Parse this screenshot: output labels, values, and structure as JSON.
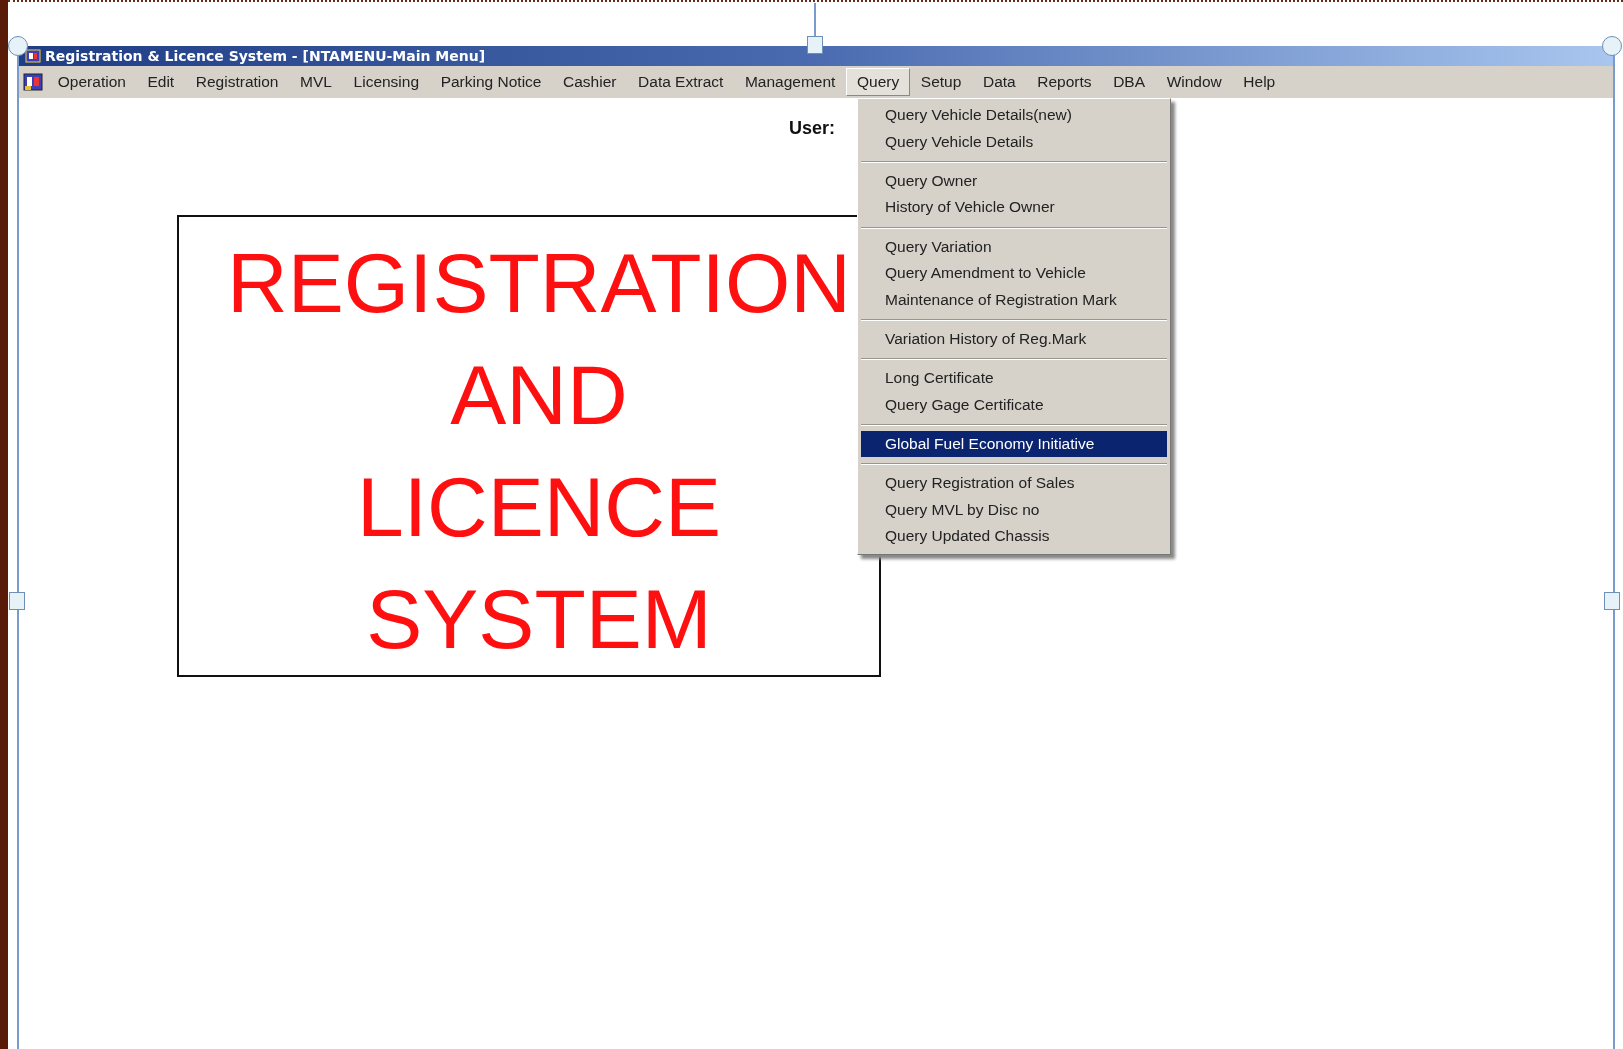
{
  "window": {
    "title": "Registration & Licence System - [NTAMENU-Main Menu]"
  },
  "menu_bar": [
    {
      "label": "Operation",
      "selected": false
    },
    {
      "label": "Edit",
      "selected": false
    },
    {
      "label": "Registration",
      "selected": false
    },
    {
      "label": "MVL",
      "selected": false
    },
    {
      "label": "Licensing",
      "selected": false
    },
    {
      "label": "Parking Notice",
      "selected": false
    },
    {
      "label": "Cashier",
      "selected": false
    },
    {
      "label": "Data Extract",
      "selected": false
    },
    {
      "label": "Management",
      "selected": false
    },
    {
      "label": "Query",
      "selected": true
    },
    {
      "label": "Setup",
      "selected": false
    },
    {
      "label": "Data",
      "selected": false
    },
    {
      "label": "Reports",
      "selected": false
    },
    {
      "label": "DBA",
      "selected": false
    },
    {
      "label": "Window",
      "selected": false
    },
    {
      "label": "Help",
      "selected": false
    }
  ],
  "user_label": "User:",
  "banner": {
    "lines": [
      "REGISTRATION",
      "AND",
      "LICENCE",
      "SYSTEM"
    ]
  },
  "dropdown": {
    "groups": [
      [
        {
          "label": "Query Vehicle Details(new)",
          "selected": false
        },
        {
          "label": "Query Vehicle Details",
          "selected": false
        }
      ],
      [
        {
          "label": "Query Owner",
          "selected": false
        },
        {
          "label": "History of Vehicle Owner",
          "selected": false
        }
      ],
      [
        {
          "label": "Query Variation",
          "selected": false
        },
        {
          "label": "Query Amendment to Vehicle",
          "selected": false
        },
        {
          "label": "Maintenance of Registration Mark",
          "selected": false
        }
      ],
      [
        {
          "label": "Variation History of Reg.Mark",
          "selected": false
        }
      ],
      [
        {
          "label": "Long Certificate",
          "selected": false
        },
        {
          "label": "Query Gage Certificate",
          "selected": false
        }
      ],
      [
        {
          "label": "Global Fuel Economy Initiative",
          "selected": true
        }
      ],
      [
        {
          "label": "Query Registration of Sales",
          "selected": false
        },
        {
          "label": "Query MVL by Disc no",
          "selected": false
        },
        {
          "label": "Query Updated Chassis",
          "selected": false
        }
      ]
    ]
  }
}
